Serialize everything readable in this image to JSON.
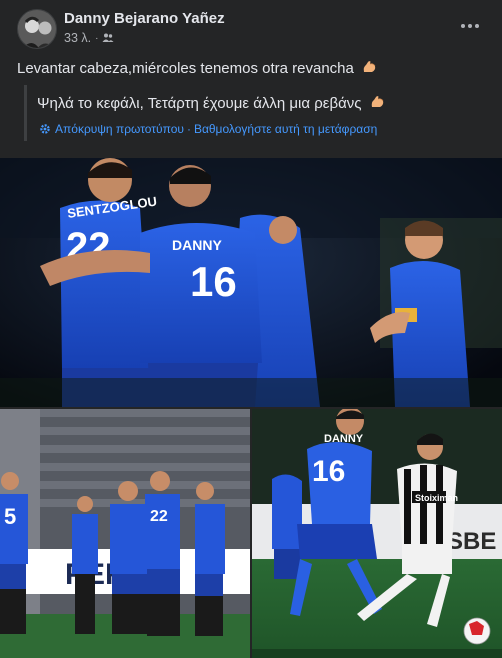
{
  "post": {
    "author": "Danny Bejarano Yañez",
    "timestamp": "33 λ.",
    "audience_icon": "friends-icon",
    "more_icon": "more-options-icon",
    "text": "Levantar cabeza,miércoles tenemos otra revancha",
    "translation": {
      "text": "Ψηλά το κεφάλι, Τετάρτη έχουμε άλλη μια ρεβάνς",
      "hide_original": "Απόκρυψη πρωτοτύπου",
      "rate_translation": "Βαθμολογήστε αυτή τη μετάφραση",
      "separator": "·",
      "icon": "gear-icon"
    },
    "emoji": "flexed-biceps-emoji"
  },
  "photos": {
    "main": {
      "jersey_name": "DANNY",
      "jersey_number": "16",
      "back_name": "SENTZOGLOU",
      "back_number": "22"
    },
    "left": {
      "jersey_number": "5",
      "jersey_number_2": "22",
      "banner_text": "PERIN"
    },
    "right": {
      "jersey_name": "DANNY",
      "jersey_number": "16",
      "opponent_sponsor": "Stoiximan",
      "ad_text": "SBE"
    }
  },
  "colors": {
    "background": "#242526",
    "text": "#e4e6eb",
    "secondary_text": "#b0b3b8",
    "link": "#4599ff",
    "kit_blue": "#1e4fd1"
  }
}
